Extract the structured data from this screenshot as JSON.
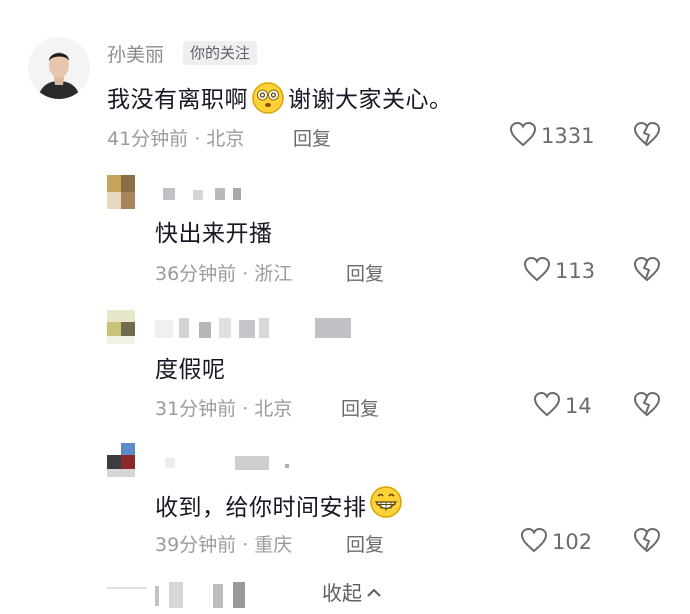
{
  "comment_main": {
    "username": "孙美丽",
    "badge": "你的关注",
    "text_before_emoji": "我没有离职啊",
    "emoji": "dizzy-face-emoji",
    "text_after_emoji": "谢谢大家关心。",
    "meta": "41分钟前 · 北京",
    "reply_label": "回复",
    "likes": "1331"
  },
  "replies": [
    {
      "text": "快出来开播",
      "meta": "36分钟前 · 浙江",
      "reply_label": "回复",
      "likes": "113"
    },
    {
      "text": "度假呢",
      "meta": "31分钟前 · 北京",
      "reply_label": "回复",
      "likes": "14"
    },
    {
      "text": "收到，给你时间安排",
      "emoji": "grinning-face-emoji",
      "meta": "39分钟前 · 重庆",
      "reply_label": "回复",
      "likes": "102"
    }
  ],
  "collapse_label": "收起",
  "icons": {
    "like": "heart-outline-icon",
    "dislike": "broken-heart-icon",
    "collapse": "chevron-up-icon"
  },
  "colors": {
    "text": "#161823",
    "secondary": "#9a9ba1",
    "icon": "#6a6b71"
  }
}
